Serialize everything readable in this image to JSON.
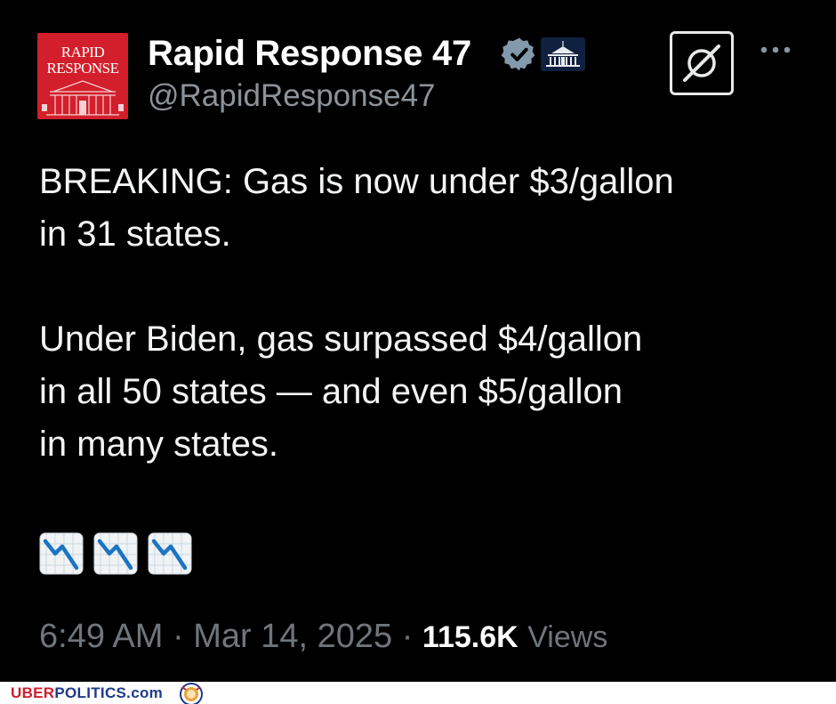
{
  "tweet": {
    "author": {
      "display_name": "Rapid Response 47",
      "handle": "@RapidResponse47",
      "avatar_line1": "RAPID",
      "avatar_line2": "RESPONSE",
      "verified_icon": "verified-badge-icon",
      "affiliation_icon": "white-house-icon"
    },
    "grok_icon": "grok-icon",
    "more_icon": "more-options-icon",
    "text": {
      "line1": "BREAKING: Gas is now under $3/gallon",
      "line2": "in 31 states.",
      "line3": "Under Biden, gas surpassed $4/gallon",
      "line4": "in all 50 states — and even $5/gallon",
      "line5": "in many states.",
      "emoji_icon": "chart-decreasing-icon"
    },
    "meta": {
      "time": "6:49 AM",
      "separator": "·",
      "date": "Mar 14, 2025",
      "views_count": "115.6K",
      "views_label": "Views"
    }
  },
  "footer": {
    "brand_part1": "UBER",
    "brand_part2": "POLITICS.com",
    "logo_icon": "uberpolitics-lion-logo-icon"
  },
  "colors": {
    "background": "#000000",
    "text": "#e7e9ea",
    "muted": "#6f767b",
    "avatar_red": "#d21f2b",
    "verified_blue": "#829aab"
  }
}
